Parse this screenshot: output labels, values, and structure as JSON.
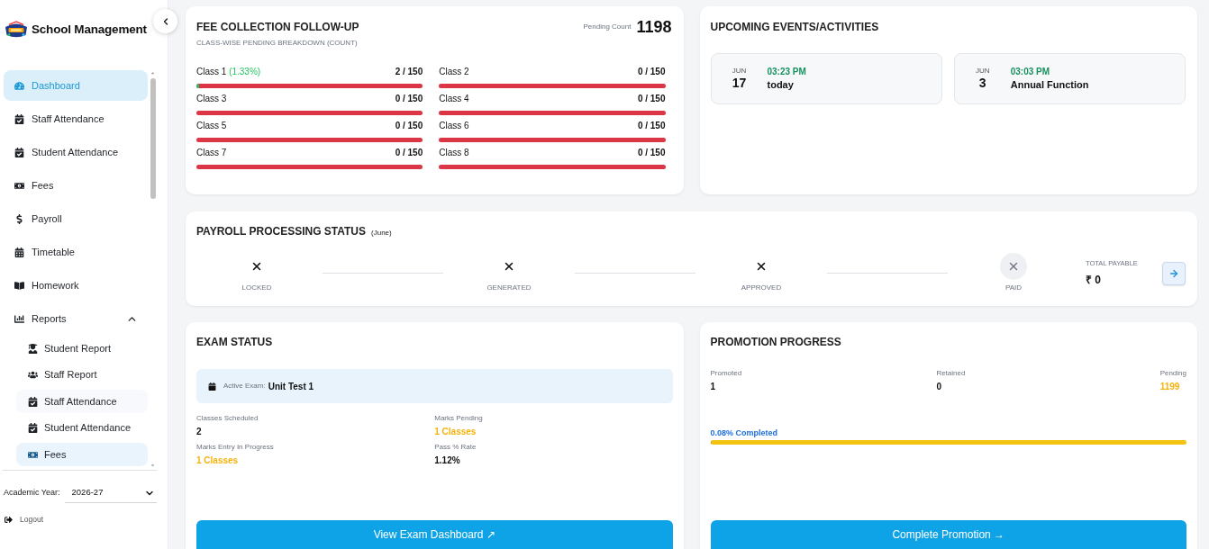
{
  "sidebar": {
    "brand": "School Management",
    "items": [
      {
        "label": "Dashboard",
        "selected": true
      },
      {
        "label": "Staff Attendance",
        "selected": false
      },
      {
        "label": "Student Attendance",
        "selected": false
      },
      {
        "label": "Fees",
        "selected": false
      },
      {
        "label": "Payroll",
        "selected": false
      },
      {
        "label": "Timetable",
        "selected": false
      },
      {
        "label": "Homework",
        "selected": false
      },
      {
        "label": "Reports",
        "selected": false,
        "expanded": true,
        "children": [
          {
            "label": "Student Report",
            "selected": false,
            "hovered": false
          },
          {
            "label": "Staff Report",
            "selected": false,
            "hovered": false
          },
          {
            "label": "Staff Attendance",
            "selected": false,
            "hovered": true
          },
          {
            "label": "Student Attendance",
            "selected": false,
            "hovered": false
          },
          {
            "label": "Fees",
            "selected": true,
            "hovered": false
          }
        ]
      }
    ],
    "academic_year": {
      "label": "Academic Year:",
      "value": "2026-27"
    },
    "logout": "Logout"
  },
  "fee_collection": {
    "title": "FEE COLLECTION FOLLOW-UP",
    "subtitle": "CLASS-WISE PENDING BREAKDOWN (COUNT)",
    "pending_label": "Pending Count",
    "pending_count": "1198",
    "classes": [
      {
        "name": "Class 1",
        "percent": "(1.33%)",
        "count": "2 / 150",
        "level": 0.0133
      },
      {
        "name": "Class 2",
        "count": "0 / 150",
        "level": 0
      },
      {
        "name": "Class 3",
        "count": "0 / 150",
        "level": 0
      },
      {
        "name": "Class 4",
        "count": "0 / 150",
        "level": 0
      },
      {
        "name": "Class 5",
        "count": "0 / 150",
        "level": 0
      },
      {
        "name": "Class 6",
        "count": "0 / 150",
        "level": 0
      },
      {
        "name": "Class 7",
        "count": "0 / 150",
        "level": 0
      },
      {
        "name": "Class 8",
        "count": "0 / 150",
        "level": 0
      }
    ]
  },
  "events": {
    "title": "UPCOMING EVENTS/ACTIVITIES",
    "items": [
      {
        "month": "JUN",
        "day": "17",
        "time": "03:23 PM",
        "title": "today"
      },
      {
        "month": "JUN",
        "day": "3",
        "time": "03:03 PM",
        "title": "Annual Function"
      }
    ]
  },
  "payroll": {
    "title": "PAYROLL PROCESSING STATUS",
    "month": "(June)",
    "steps": [
      {
        "label": "LOCKED",
        "done": false,
        "current": false
      },
      {
        "label": "GENERATED",
        "done": false,
        "current": false
      },
      {
        "label": "APPROVED",
        "done": false,
        "current": false
      },
      {
        "label": "PAID",
        "done": false,
        "current": true
      }
    ],
    "total_label": "TOTAL PAYABLE",
    "total": "₹ 0"
  },
  "exam": {
    "title": "EXAM STATUS",
    "active_label": "Active Exam:",
    "active_exam": "Unit Test 1",
    "stats": [
      {
        "label": "Classes Scheduled",
        "value": "2",
        "highlight": false
      },
      {
        "label": "Marks Pending",
        "value": "1 Classes",
        "highlight": true
      },
      {
        "label": "Marks Entry In Progress",
        "value": "1 Classes",
        "highlight": true
      },
      {
        "label": "Pass % Rate",
        "value": "1.12%",
        "highlight": false
      }
    ],
    "button": "View Exam Dashboard ↗"
  },
  "promotion": {
    "title": "PROMOTION PROGRESS",
    "stats": [
      {
        "label": "Promoted",
        "value": "1",
        "highlight": false
      },
      {
        "label": "Retained",
        "value": "0",
        "highlight": false
      },
      {
        "label": "Pending",
        "value": "1199",
        "highlight": true
      }
    ],
    "progress_text": "0.08% Completed",
    "level": 0.0008,
    "button": "Complete Promotion →"
  }
}
